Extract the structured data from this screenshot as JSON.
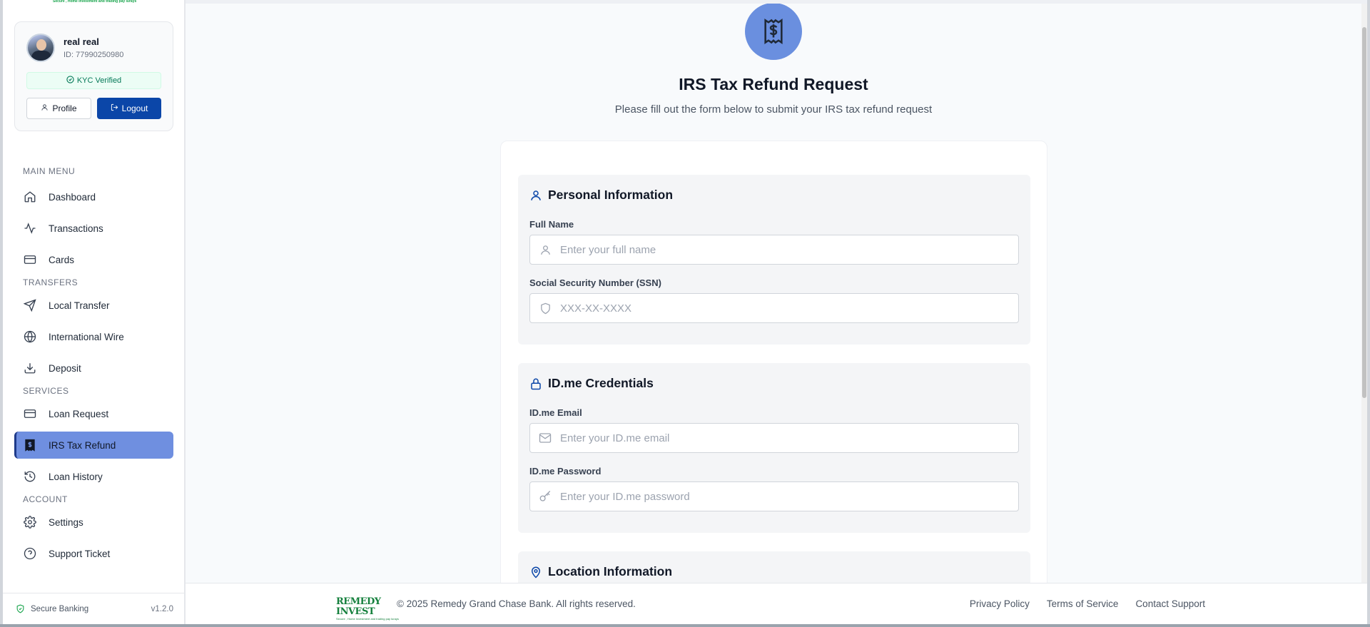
{
  "brand": {
    "tagline": "Secure , Home Investment and trading pay lurays",
    "logo_word": "REMEDY INVEST",
    "logo_tagline": "Secure , Home Investment and trading pay lurays"
  },
  "user": {
    "name": "real real",
    "id_text": "ID: 77990250980",
    "kyc_label": "KYC Verified",
    "profile_label": "Profile",
    "logout_label": "Logout"
  },
  "nav": {
    "main_menu_label": "MAIN MENU",
    "transfers_label": "TRANSFERS",
    "services_label": "SERVICES",
    "account_label": "ACCOUNT",
    "dashboard": "Dashboard",
    "transactions": "Transactions",
    "cards": "Cards",
    "local_transfer": "Local Transfer",
    "international_wire": "International Wire",
    "deposit": "Deposit",
    "loan_request": "Loan Request",
    "irs_tax_refund": "IRS Tax Refund",
    "loan_history": "Loan History",
    "settings": "Settings",
    "support_ticket": "Support Ticket"
  },
  "sidebar_footer": {
    "secure_label": "Secure Banking",
    "version": "v1.2.0"
  },
  "page": {
    "title": "IRS Tax Refund Request",
    "subtitle": "Please fill out the form below to submit your IRS tax refund request"
  },
  "sections": {
    "personal": {
      "title": "Personal Information",
      "full_name_label": "Full Name",
      "full_name_placeholder": "Enter your full name",
      "ssn_label": "Social Security Number (SSN)",
      "ssn_placeholder": "XXX-XX-XXXX"
    },
    "idme": {
      "title": "ID.me Credentials",
      "email_label": "ID.me Email",
      "email_placeholder": "Enter your ID.me email",
      "password_label": "ID.me Password",
      "password_placeholder": "Enter your ID.me password"
    },
    "location": {
      "title": "Location Information"
    }
  },
  "footer": {
    "copyright": "© 2025 Remedy Grand Chase Bank. All rights reserved.",
    "privacy": "Privacy Policy",
    "terms": "Terms of Service",
    "contact": "Contact Support"
  },
  "colors": {
    "primary": "#0b46a8",
    "active_nav": "#6f8fe0",
    "success": "#16a34a"
  }
}
